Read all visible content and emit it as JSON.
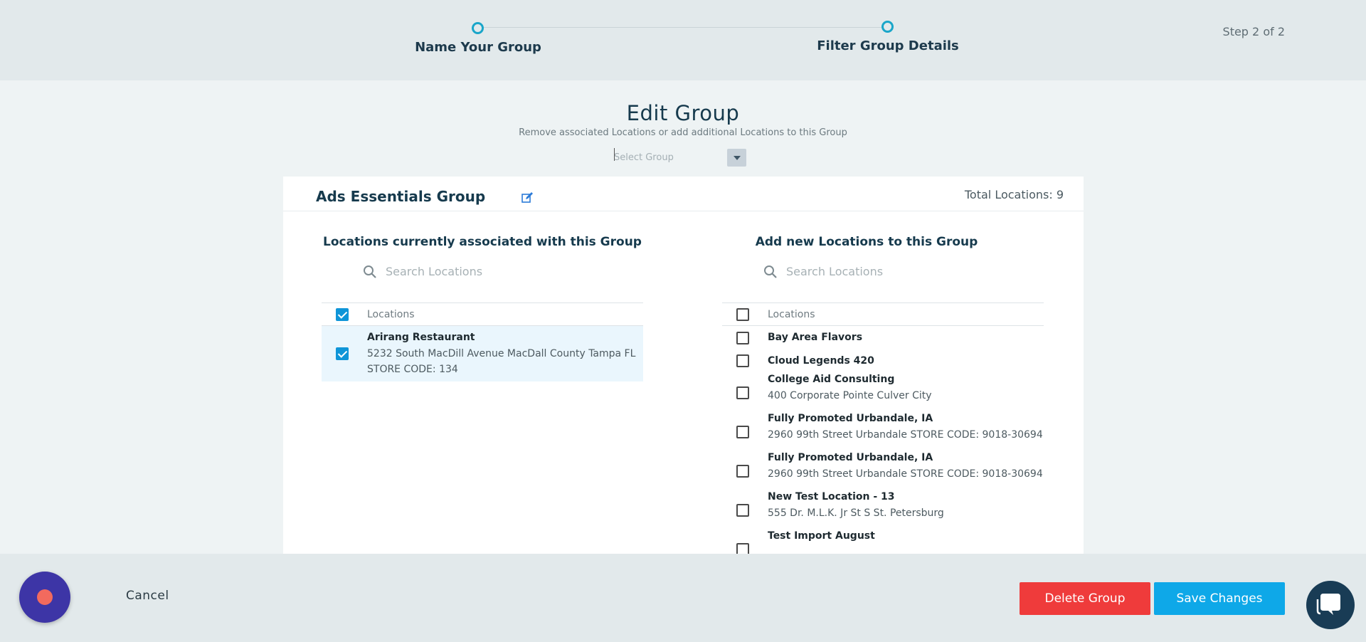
{
  "stepper": {
    "steps": [
      {
        "label": "Name Your Group"
      },
      {
        "label": "Filter Group Details"
      }
    ],
    "step_count": "Step 2 of 2"
  },
  "page": {
    "title": "Edit Group",
    "subtitle": "Remove associated Locations or add additional Locations to this Group",
    "select_placeholder": "Select Group"
  },
  "group": {
    "name": "Ads Essentials Group",
    "total_locations": "Total Locations: 9"
  },
  "associated": {
    "title": "Locations currently associated with this Group",
    "search_placeholder": "Search Locations",
    "header_label": "Locations",
    "header_checked": true,
    "rows": [
      {
        "name": "Arirang Restaurant",
        "lines": [
          "5232 South MacDill Avenue MacDall County Tampa FL",
          "STORE CODE: 134"
        ],
        "checked": true
      }
    ]
  },
  "available": {
    "title": "Add new Locations to this Group",
    "search_placeholder": "Search Locations",
    "header_label": "Locations",
    "header_checked": false,
    "rows": [
      {
        "name": "Bay Area Flavors",
        "lines": [],
        "checked": false
      },
      {
        "name": "Cloud Legends 420",
        "lines": [],
        "checked": false
      },
      {
        "name": "College Aid Consulting",
        "lines": [
          "400 Corporate Pointe Culver City"
        ],
        "checked": false
      },
      {
        "name": "Fully Promoted Urbandale, IA",
        "lines": [
          "2960 99th Street Urbandale STORE CODE: 9018-30694"
        ],
        "checked": false
      },
      {
        "name": "Fully Promoted Urbandale, IA",
        "lines": [
          "2960 99th Street Urbandale STORE CODE: 9018-30694"
        ],
        "checked": false
      },
      {
        "name": "New Test Location - 13",
        "lines": [
          "555 Dr. M.L.K. Jr St S St. Petersburg"
        ],
        "checked": false
      },
      {
        "name": "Test Import August",
        "lines": [],
        "checked": false
      }
    ]
  },
  "footer": {
    "cancel_label": "Cancel",
    "delete_label": "Delete Group",
    "save_label": "Save Changes"
  }
}
